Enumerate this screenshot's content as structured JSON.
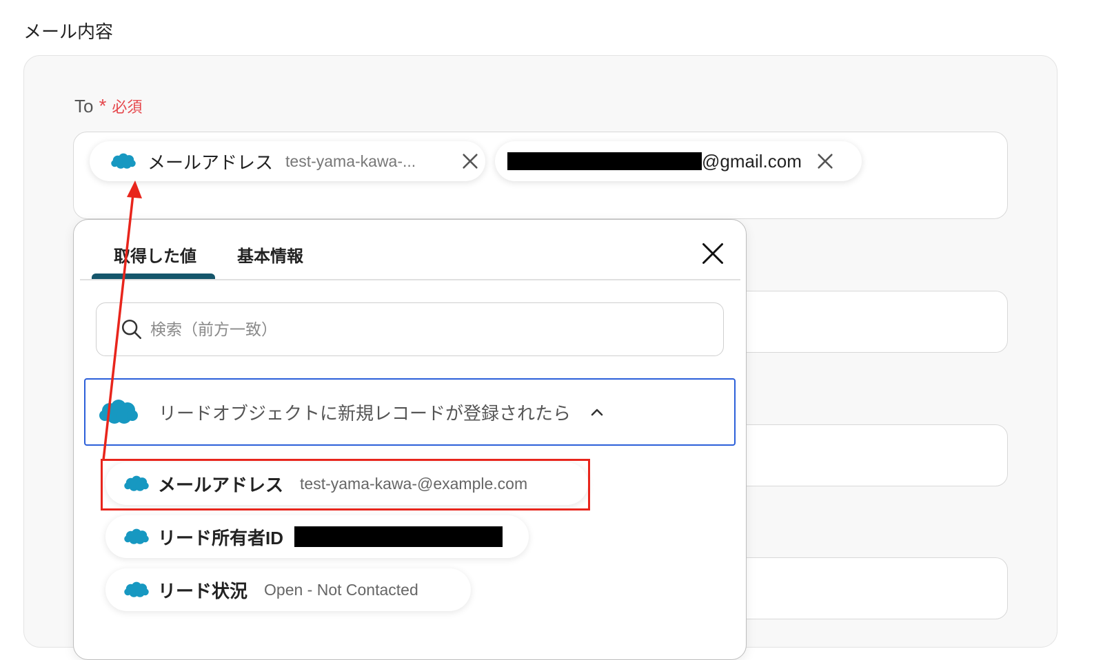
{
  "section_title": "メール内容",
  "to_field": {
    "label": "To",
    "required_mark": "*",
    "required_text": "必須",
    "chips": [
      {
        "label": "メールアドレス",
        "value": "test-yama-kawa-..."
      },
      {
        "value": "@gmail.com"
      }
    ]
  },
  "dropdown": {
    "tabs": [
      {
        "label": "取得した値",
        "active": true
      },
      {
        "label": "基本情報",
        "active": false
      }
    ],
    "search": {
      "placeholder": "検索（前方一致）",
      "value": ""
    },
    "group": {
      "label": "リードオブジェクトに新規レコードが登録されたら",
      "expanded": true,
      "items": [
        {
          "label": "メールアドレス",
          "value": "test-yama-kawa-@example.com"
        },
        {
          "label": "リード所有者ID",
          "value": ""
        },
        {
          "label": "リード状況",
          "value": "Open - Not Contacted"
        }
      ]
    }
  },
  "colors": {
    "accent_tab": "#15566b",
    "required": "#e5484d",
    "annotation": "#e8251c",
    "salesforce": "#1798c1",
    "group_border": "#2b5fd9"
  },
  "icons": {
    "source": "salesforce-cloud-icon",
    "remove": "close-icon",
    "search": "search-icon",
    "collapse": "chevron-up-icon"
  }
}
